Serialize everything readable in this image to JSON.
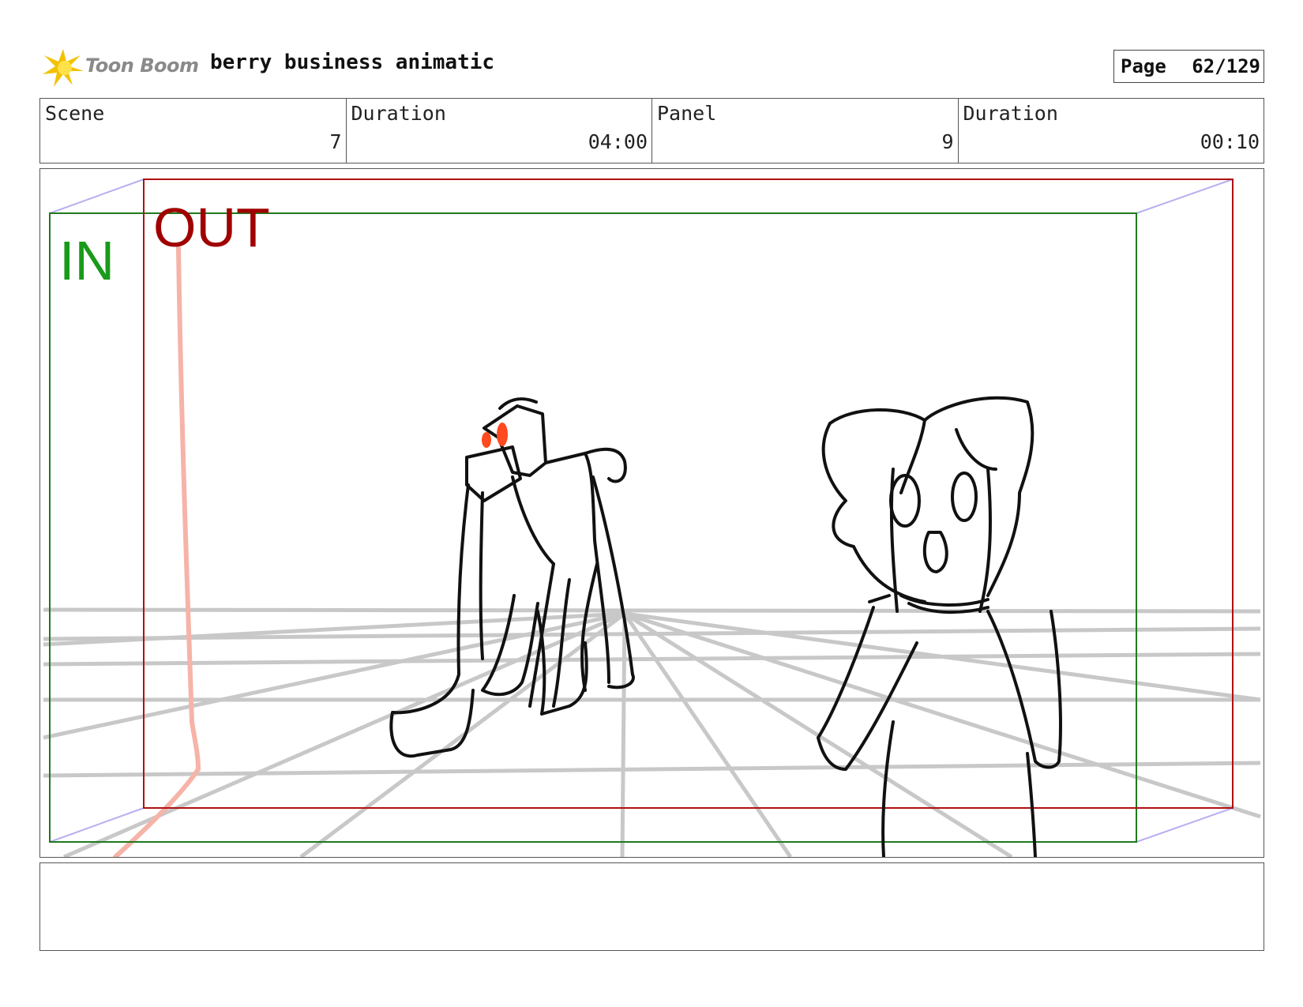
{
  "header": {
    "logo_text": "Toon Boom",
    "title": "berry business animatic",
    "page_label": "Page",
    "page_value": "62/129"
  },
  "info": {
    "scene_label": "Scene",
    "scene_value": "7",
    "scene_duration_label": "Duration",
    "scene_duration_value": "04:00",
    "panel_label": "Panel",
    "panel_value": "9",
    "panel_duration_label": "Duration",
    "panel_duration_value": "00:10"
  },
  "frame": {
    "in_label": "IN",
    "out_label": "OUT",
    "in_color": "#1a9a1a",
    "out_color": "#a00000"
  },
  "notes": {
    "text": ""
  }
}
